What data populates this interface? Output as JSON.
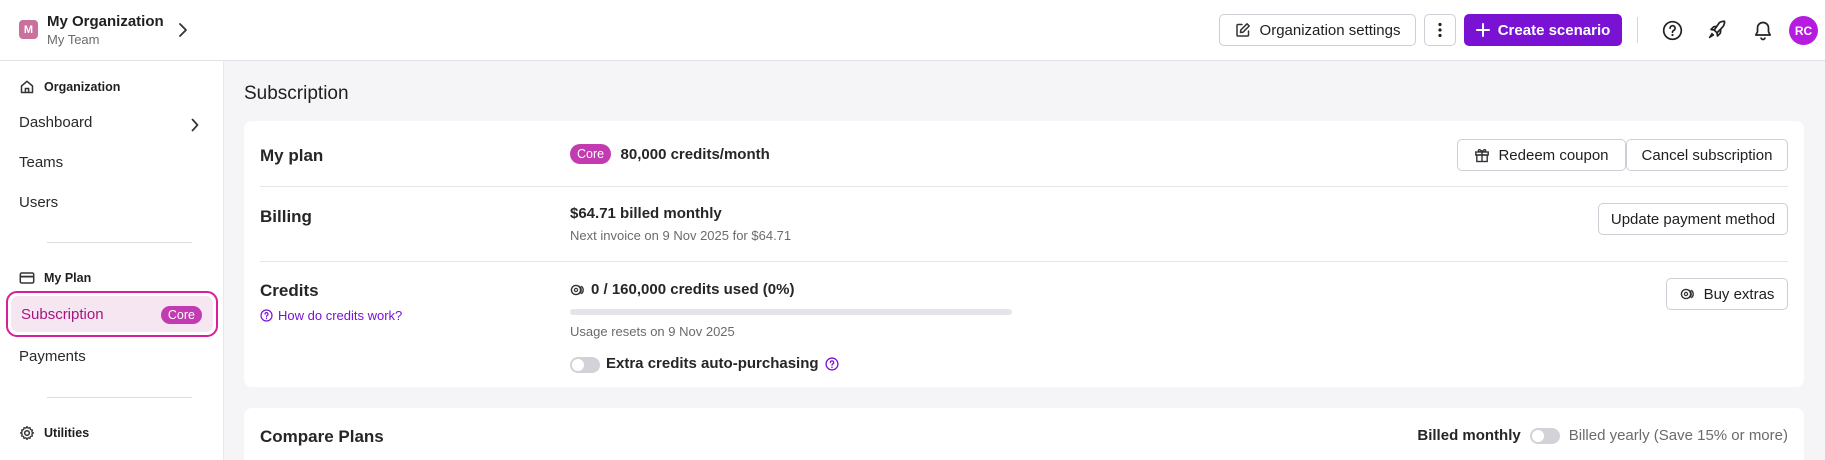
{
  "header": {
    "org_initial": "M",
    "org_name": "My Organization",
    "team_name": "My Team",
    "org_settings_label": "Organization settings",
    "create_scenario_label": "Create scenario",
    "user_initials": "RC"
  },
  "sidebar": {
    "section_organization": "Organization",
    "items_org": [
      "Dashboard",
      "Teams",
      "Users"
    ],
    "section_plan": "My Plan",
    "active_item": "Subscription",
    "active_badge": "Core",
    "item_payments": "Payments",
    "section_utilities": "Utilities"
  },
  "main": {
    "page_title": "Subscription",
    "plan": {
      "label": "My plan",
      "badge": "Core",
      "credits": "80,000 credits/month",
      "redeem_label": "Redeem coupon",
      "cancel_label": "Cancel subscription"
    },
    "billing": {
      "label": "Billing",
      "amount": "$64.71 billed monthly",
      "next_invoice": "Next invoice on 9 Nov 2025 for $64.71",
      "update_label": "Update payment method"
    },
    "credits": {
      "label": "Credits",
      "help_link": "How do credits work?",
      "used_text": "0 / 160,000 credits used (0%)",
      "used_fraction": 0,
      "reset_text": "Usage resets on 9 Nov 2025",
      "auto_purchase_label": "Extra credits auto-purchasing",
      "auto_purchase_enabled": false,
      "buy_label": "Buy extras"
    },
    "compare": {
      "title": "Compare Plans",
      "billed_monthly": "Billed monthly",
      "billed_yearly": "Billed yearly (Save 15% or more)"
    }
  },
  "colors": {
    "accent": "#7a12d4",
    "badge": "#c23bb0",
    "active_outline": "#d71e9b"
  }
}
